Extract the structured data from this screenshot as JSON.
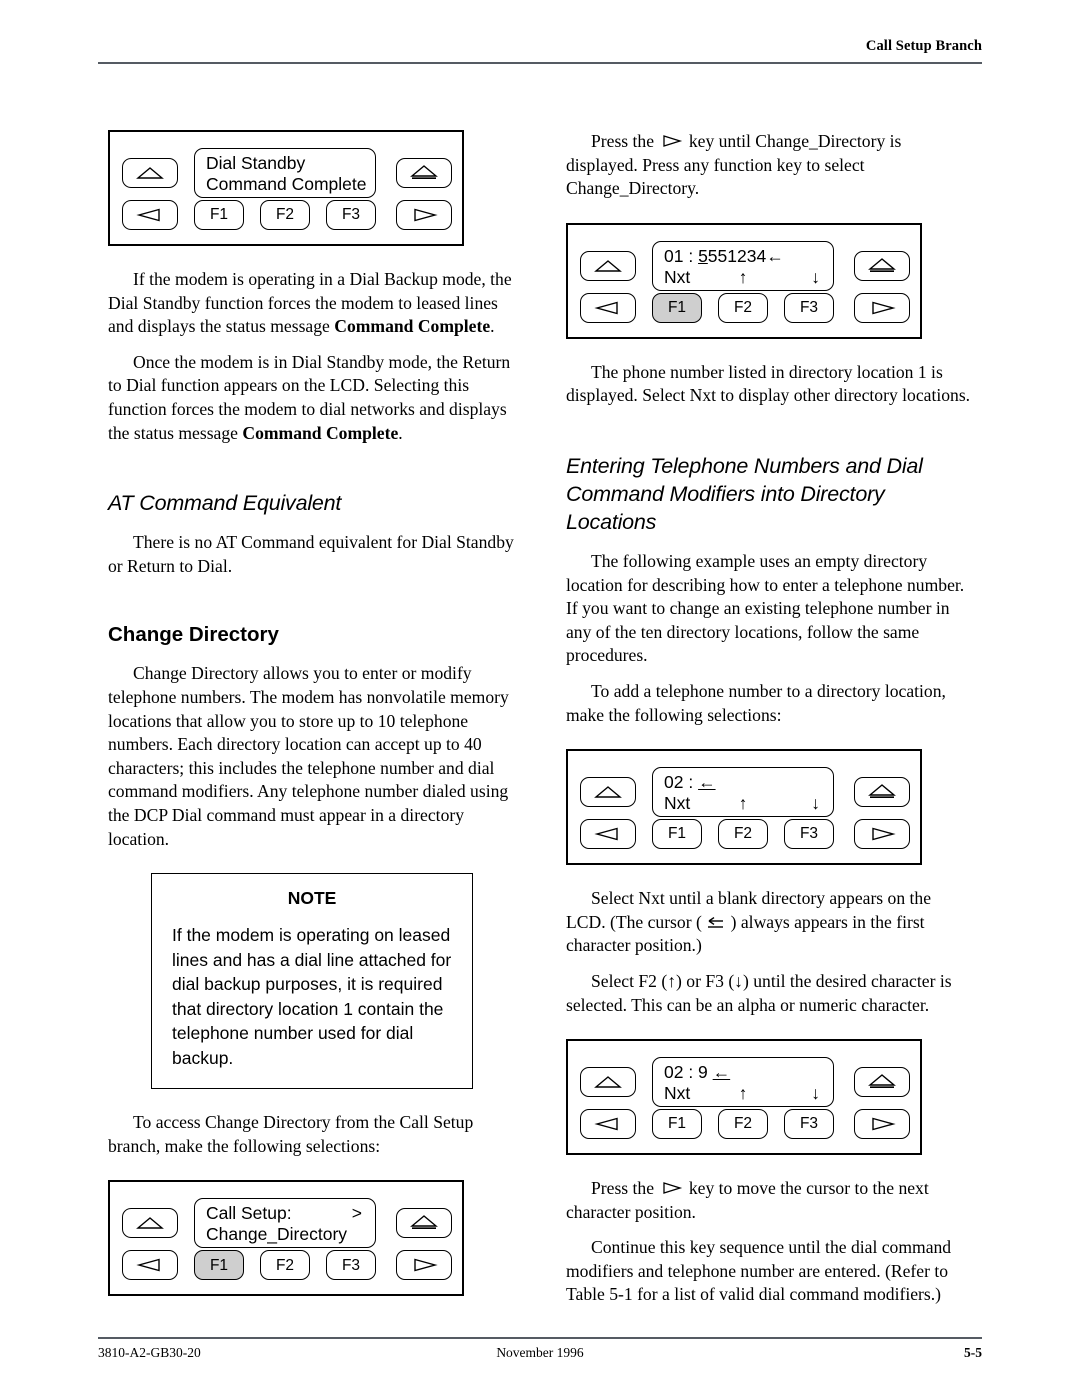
{
  "header": {
    "running_head": "Call Setup Branch"
  },
  "footer": {
    "doc_number": "3810-A2-GB30-20",
    "date": "November 1996",
    "page_number": "5-5"
  },
  "left_column": {
    "panel_dial_standby": {
      "name": "dial-standby-panel",
      "lcd_line1": "Dial Standby",
      "lcd_line2": "Command Complete",
      "keys": {
        "f1": "F1",
        "f2": "F2",
        "f3": "F3"
      },
      "selected_key": ""
    },
    "para_1_a": "If the modem is operating in a Dial Backup mode, the Dial Standby function forces the modem to leased lines and displays the status message ",
    "para_1_bold": "Command Complete",
    "para_1_end": ".",
    "para_2_a": "Once the modem is in Dial Standby mode, the Return to Dial function appears on the LCD. Selecting this function forces the modem to dial networks and displays the status message ",
    "para_2_bold": "Command Complete",
    "para_2_end": ".",
    "heading_at_command": "AT Command Equivalent",
    "para_3": "There is no AT Command equivalent for Dial Standby or Return to Dial.",
    "heading_change_directory": "Change Directory",
    "para_4": "Change Directory allows you to enter or modify telephone numbers. The modem has nonvolatile memory locations that allow you to store up to 10 telephone numbers. Each directory location can accept up to 40 characters; this includes the telephone number and dial command modifiers. Any telephone number dialed using the DCP Dial command must appear in a directory location.",
    "note": {
      "title": "NOTE",
      "body": "If the modem is operating on leased lines and has a dial line attached for dial backup purposes, it is required that directory location 1 contain the telephone number used for dial backup."
    },
    "para_5": "To access Change Directory from the Call Setup branch, make the following selections:",
    "panel_call_setup": {
      "name": "call-setup-panel",
      "lcd_line1": "Call Setup:",
      "lcd_line1_right": ">",
      "lcd_line2": "Change_Directory",
      "keys": {
        "f1": "F1",
        "f2": "F2",
        "f3": "F3"
      },
      "selected_key": "F1"
    }
  },
  "right_column": {
    "para_1_a": "Press the ",
    "para_1_b": " key until Change_Directory is displayed. Press any function key to select Change_Directory.",
    "panel_dir_01": {
      "name": "directory-01-panel",
      "lcd_line1_prefix": "01 : ",
      "lcd_line1_cursor": "5",
      "lcd_line1_rest": "551234",
      "lcd_line1_arrow": "←",
      "lcd_line2": "Nxt",
      "lcd_line2_mid": "↑",
      "lcd_line2_right": "↓",
      "keys": {
        "f1": "F1",
        "f2": "F2",
        "f3": "F3"
      },
      "selected_key": "F1"
    },
    "para_2": "The phone number listed in directory location 1 is displayed. Select Nxt to display other directory locations.",
    "heading_entering": "Entering Telephone Numbers and Dial Command Modifiers into Directory Locations",
    "para_3": "The following example uses an empty directory location for describing how to enter a telephone number. If you want to change an existing telephone number in any of the ten directory locations, follow the same procedures.",
    "para_4": "To add a telephone number to a directory location, make the following selections:",
    "panel_dir_02_blank": {
      "name": "directory-02-blank-panel",
      "lcd_line1_prefix": "02 : ",
      "lcd_line1_cursor": "",
      "lcd_line1_arrow": "←",
      "lcd_line2": "Nxt",
      "lcd_line2_mid": "↑",
      "lcd_line2_right": "↓",
      "keys": {
        "f1": "F1",
        "f2": "F2",
        "f3": "F3"
      },
      "selected_key": ""
    },
    "para_5_a": "Select Nxt until a blank directory appears on the LCD. (The cursor ( ",
    "para_5_b": " ) always appears in the first character position.)",
    "para_6": "Select F2 (↑) or F3 (↓) until the desired character is selected. This can be an alpha or numeric character.",
    "panel_dir_02_nine": {
      "name": "directory-02-nine-panel",
      "lcd_line1_prefix": "02 : 9 ",
      "lcd_line1_arrow": "←",
      "lcd_line2": "Nxt",
      "lcd_line2_mid": "↑",
      "lcd_line2_right": "↓",
      "keys": {
        "f1": "F1",
        "f2": "F2",
        "f3": "F3"
      },
      "selected_key": ""
    },
    "para_7_a": "Press the ",
    "para_7_b": " key to move the cursor to the next character position.",
    "para_8": "Continue this key sequence until the dial command modifiers and telephone number are entered. (Refer to Table 5-1 for a list of valid dial command modifiers.)"
  }
}
